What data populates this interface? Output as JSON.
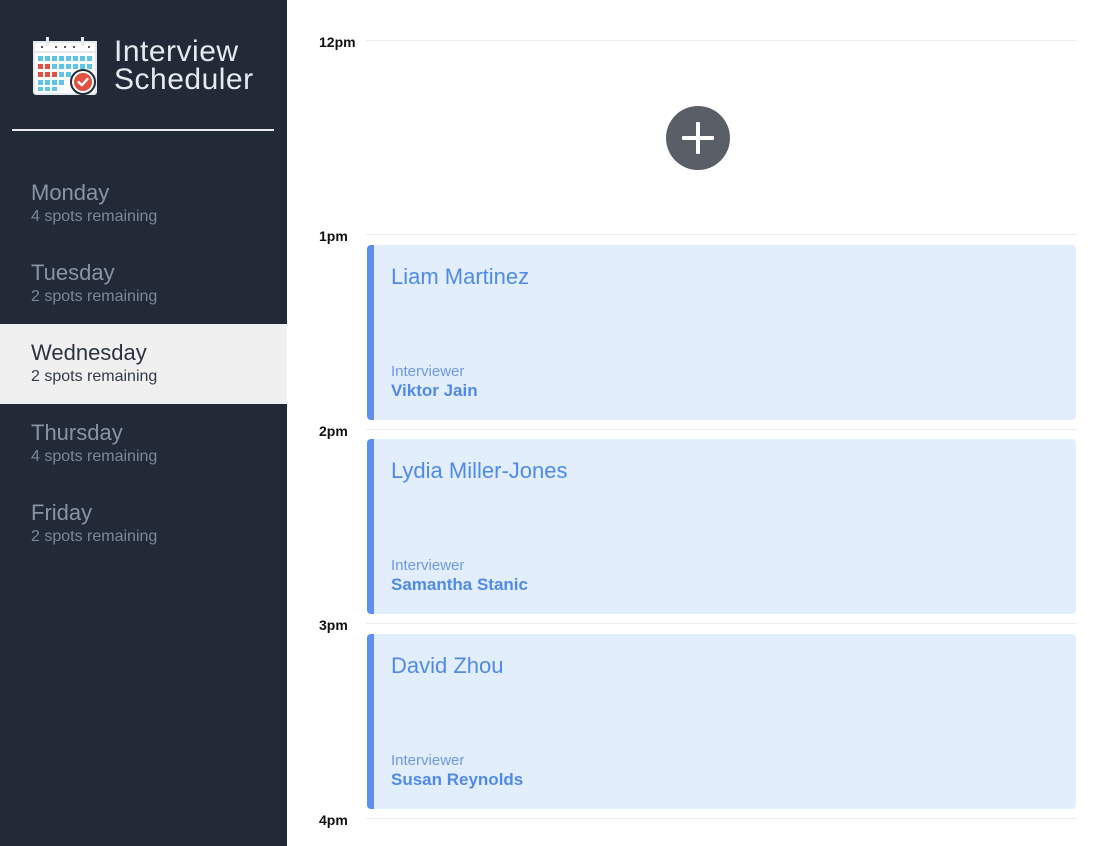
{
  "app": {
    "title_line1": "Interview",
    "title_line2": "Scheduler"
  },
  "days": [
    {
      "name": "Monday",
      "spots": "4 spots remaining",
      "selected": false
    },
    {
      "name": "Tuesday",
      "spots": "2 spots remaining",
      "selected": false
    },
    {
      "name": "Wednesday",
      "spots": "2 spots remaining",
      "selected": true
    },
    {
      "name": "Thursday",
      "spots": "4 spots remaining",
      "selected": false
    },
    {
      "name": "Friday",
      "spots": "2 spots remaining",
      "selected": false
    }
  ],
  "schedule": {
    "times": [
      "12pm",
      "1pm",
      "2pm",
      "3pm",
      "4pm"
    ],
    "add_icon": "plus-icon",
    "appointments": [
      {
        "student": "Liam Martinez",
        "interviewer_label": "Interviewer",
        "interviewer": "Viktor Jain"
      },
      {
        "student": "Lydia Miller-Jones",
        "interviewer_label": "Interviewer",
        "interviewer": "Samantha Stanic"
      },
      {
        "student": "David Zhou",
        "interviewer_label": "Interviewer",
        "interviewer": "Susan Reynolds"
      }
    ]
  },
  "colors": {
    "sidebar_bg": "#222a38",
    "selected_bg": "#f0f0f0",
    "appointment_bg": "#e3eefd",
    "appointment_accent": "#5b8ff0",
    "add_button": "#5a5f67"
  }
}
